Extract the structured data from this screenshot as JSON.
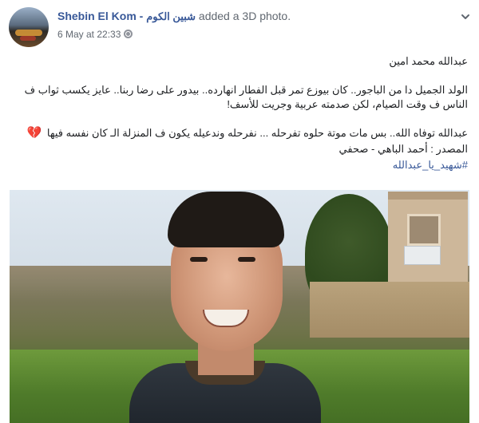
{
  "post": {
    "page_name": "Shebin El Kom",
    "separator": " - ",
    "page_name_ar": "شبين الكوم",
    "action": " added a 3D photo.",
    "timestamp": "6 May at 22:33",
    "author_line": "عبدالله محمد امين",
    "body": "الولد الجميل دا من الباجور.. كان بيوزع تمر قبل الفطار انهارده.. بيدور على رضا ربنا.. عايز يكسب ثواب ف الناس ف وقت الصيام، لكن صدمته عربية وجريت للأسف!",
    "condolence": "عبدالله توفاه الله.. بس مات موتة حلوه تفرحله ... نفرحله وندعيله يكون ف المنزلة الـ كان نفسه فيها",
    "heart": "💔",
    "source": "المصدر : أحمد الباهي - صحفي",
    "hashtag": "#شهيد_يا_عبدالله"
  },
  "icons": {
    "globe": "globe-icon",
    "menu": "chevron-down-icon",
    "heart": "broken-heart-icon"
  },
  "colors": {
    "link": "#385898",
    "meta": "#606770",
    "text": "#1c1e21"
  }
}
